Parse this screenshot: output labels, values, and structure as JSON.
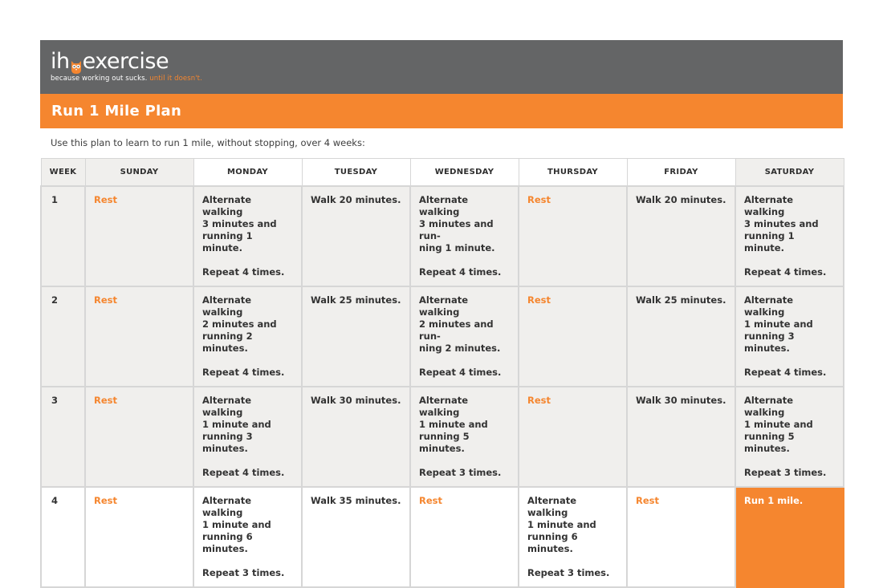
{
  "brand": {
    "name_left": "ih",
    "name_right": "exercise",
    "tagline": "because working out sucks.",
    "tagline_accent": " until it doesn't.",
    "logo_icon": "owl-icon"
  },
  "plan_title": "Run 1 Mile Plan",
  "intro": "Use this plan to learn to run 1 mile, without stopping, over 4 weeks:",
  "columns": [
    "WEEK",
    "SUNDAY",
    "MONDAY",
    "TUESDAY",
    "WEDNESDAY",
    "THURSDAY",
    "FRIDAY",
    "SATURDAY"
  ],
  "weeks": [
    {
      "week": "1",
      "sunday": "Rest",
      "monday": [
        "Alternate walking",
        "3 minutes and",
        "running 1 minute."
      ],
      "monday_repeat": "Repeat 4 times.",
      "tuesday": "Walk 20 minutes.",
      "wednesday": [
        "Alternate walking",
        "3 minutes and run-",
        "ning 1 minute."
      ],
      "wednesday_repeat": "Repeat 4 times.",
      "thursday": "Rest",
      "friday": "Walk 20 minutes.",
      "saturday": [
        "Alternate walking",
        "3 minutes and",
        "running 1 minute."
      ],
      "saturday_repeat": "Repeat 4 times."
    },
    {
      "week": "2",
      "sunday": "Rest",
      "monday": [
        "Alternate walking",
        "2 minutes and",
        "running 2 minutes."
      ],
      "monday_repeat": "Repeat 4 times.",
      "tuesday": "Walk 25 minutes.",
      "wednesday": [
        "Alternate walking",
        "2 minutes and run-",
        "ning 2 minutes."
      ],
      "wednesday_repeat": "Repeat 4 times.",
      "thursday": "Rest",
      "friday": "Walk 25 minutes.",
      "saturday": [
        "Alternate walking",
        "1 minute and",
        "running 3 minutes."
      ],
      "saturday_repeat": "Repeat 4 times."
    },
    {
      "week": "3",
      "sunday": "Rest",
      "monday": [
        "Alternate walking",
        "1 minute and",
        "running 3 minutes."
      ],
      "monday_repeat": "Repeat 4 times.",
      "tuesday": "Walk 30 minutes.",
      "wednesday": [
        "Alternate walking",
        "1 minute and",
        "running 5 minutes."
      ],
      "wednesday_repeat": "Repeat 3 times.",
      "thursday": "Rest",
      "friday": "Walk 30 minutes.",
      "saturday": [
        "Alternate walking",
        "1 minute and",
        "running 5 minutes."
      ],
      "saturday_repeat": "Repeat 3 times."
    },
    {
      "week": "4",
      "sunday": "Rest",
      "monday": [
        "Alternate walking",
        "1 minute and",
        "running 6 minutes."
      ],
      "monday_repeat": "Repeat 3 times.",
      "tuesday": "Walk 35 minutes.",
      "wednesday": "Rest",
      "thursday": [
        "Alternate walking",
        "1 minute and",
        "running 6 minutes."
      ],
      "thursday_repeat": "Repeat 3 times.",
      "friday": "Rest",
      "saturday": "Run 1 mile."
    }
  ],
  "colors": {
    "banner": "#646566",
    "accent": "#f5862f",
    "cell_shade": "#f0efed",
    "grid": "#d6d6d6"
  }
}
